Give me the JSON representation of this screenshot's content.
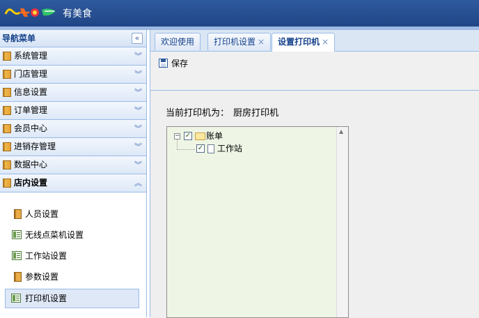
{
  "header": {
    "app_title": "有美食"
  },
  "sidebar": {
    "title": "导航菜单",
    "collapse_glyph": "«",
    "groups": [
      {
        "label": "系统管理",
        "chevron": "︾"
      },
      {
        "label": "门店管理",
        "chevron": "︾"
      },
      {
        "label": "信息设置",
        "chevron": "︾"
      },
      {
        "label": "订单管理",
        "chevron": "︾"
      },
      {
        "label": "会员中心",
        "chevron": "︾"
      },
      {
        "label": "进销存管理",
        "chevron": "︾"
      },
      {
        "label": "数据中心",
        "chevron": "︾"
      },
      {
        "label": "店内设置",
        "chevron": "︽"
      }
    ],
    "sub_items": [
      {
        "label": "人员设置"
      },
      {
        "label": "无线点菜机设置"
      },
      {
        "label": "工作站设置"
      },
      {
        "label": "参数设置"
      },
      {
        "label": "打印机设置"
      }
    ]
  },
  "tabs": [
    {
      "label": "欢迎使用",
      "closable": false
    },
    {
      "label": "打印机设置",
      "closable": true
    },
    {
      "label": "设置打印机",
      "closable": true,
      "active": true
    }
  ],
  "tab_close_glyph": "×",
  "toolbar": {
    "save_label": "保存"
  },
  "content": {
    "current_printer_label": "当前打印机为：",
    "current_printer_value": "厨房打印机",
    "tree": {
      "root": {
        "label": "账单",
        "checked": true,
        "expanded": true
      },
      "child": {
        "label": "工作站",
        "checked": true
      }
    },
    "toggle_glyph": "−",
    "check_glyph": "✓",
    "scroll_up_glyph": "▲"
  },
  "colors": {
    "header": "#254c8f",
    "panel_border": "#99bbe8",
    "tree_bg": "#eef5e4"
  }
}
